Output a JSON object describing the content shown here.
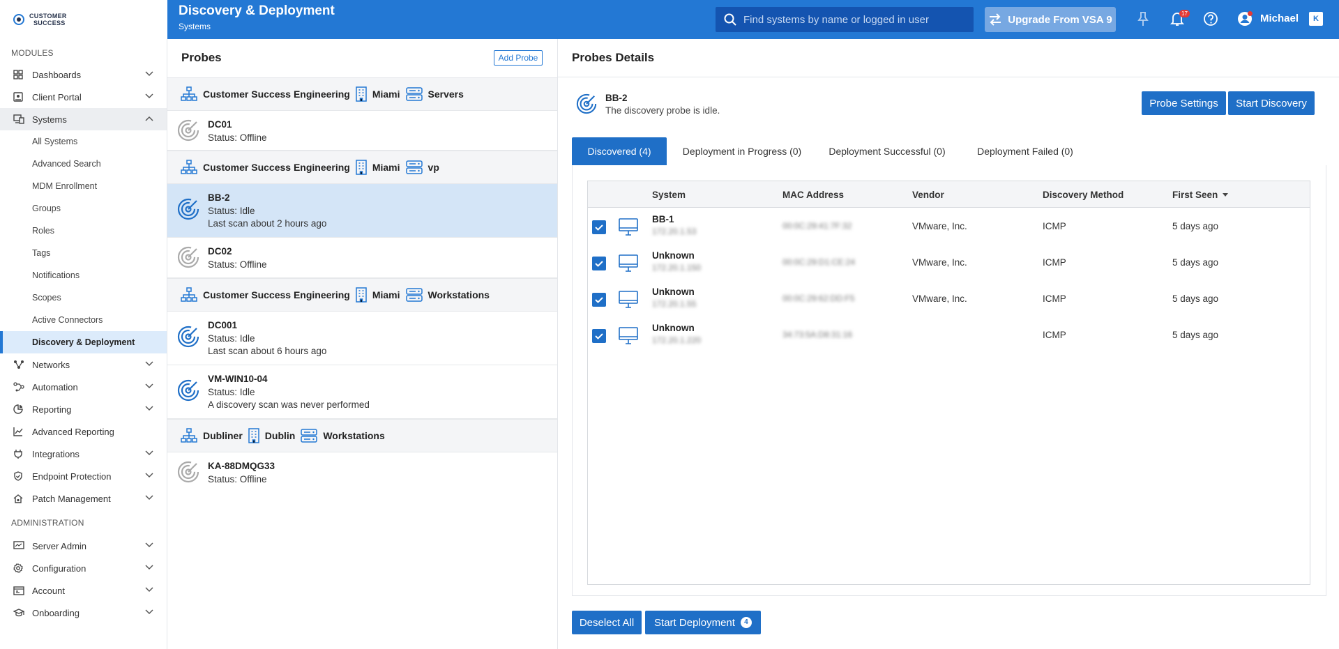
{
  "brand": {
    "logo_line1": "CUSTOMER",
    "logo_line2": "SUCCESS"
  },
  "header": {
    "title": "Discovery & Deployment",
    "subtitle": "Systems",
    "search_placeholder": "Find systems by name or logged in user",
    "upgrade_label": "Upgrade From VSA 9",
    "notification_count": "17",
    "user_name": "Michael",
    "app_badge": "K"
  },
  "sidebar": {
    "modules_label": "MODULES",
    "admin_label": "ADMINISTRATION",
    "items": [
      {
        "label": "Dashboards",
        "icon": "grid-icon"
      },
      {
        "label": "Client Portal",
        "icon": "portal-icon"
      },
      {
        "label": "Systems",
        "icon": "systems-icon"
      },
      {
        "label": "Networks",
        "icon": "network-icon"
      },
      {
        "label": "Automation",
        "icon": "automation-icon"
      },
      {
        "label": "Reporting",
        "icon": "reporting-icon"
      },
      {
        "label": "Advanced Reporting",
        "icon": "chart-line-icon"
      },
      {
        "label": "Integrations",
        "icon": "plug-icon"
      },
      {
        "label": "Endpoint Protection",
        "icon": "shield-icon"
      },
      {
        "label": "Patch Management",
        "icon": "home-gear-icon"
      }
    ],
    "systems_sub": [
      "All Systems",
      "Advanced Search",
      "MDM Enrollment",
      "Groups",
      "Roles",
      "Tags",
      "Notifications",
      "Scopes",
      "Active Connectors",
      "Discovery & Deployment"
    ],
    "admin_items": [
      {
        "label": "Server Admin",
        "icon": "server-admin-icon"
      },
      {
        "label": "Configuration",
        "icon": "gear-icon"
      },
      {
        "label": "Account",
        "icon": "account-icon"
      },
      {
        "label": "Onboarding",
        "icon": "graduation-cap-icon"
      }
    ]
  },
  "probes": {
    "title": "Probes",
    "add_label": "Add Probe",
    "groups": [
      {
        "org": "Customer Success Engineering",
        "site": "Miami",
        "group": "Servers"
      },
      {
        "org": "Customer Success Engineering",
        "site": "Miami",
        "group": "vp"
      },
      {
        "org": "Customer Success Engineering",
        "site": "Miami",
        "group": "Workstations"
      },
      {
        "org": "Dubliner",
        "site": "Dublin",
        "group": "Workstations"
      }
    ],
    "items": [
      {
        "name": "DC01",
        "status": "Status: Offline",
        "scan": ""
      },
      {
        "name": "BB-2",
        "status": "Status: Idle",
        "scan": "Last scan about 2 hours ago"
      },
      {
        "name": "DC02",
        "status": "Status: Offline",
        "scan": ""
      },
      {
        "name": "DC001",
        "status": "Status: Idle",
        "scan": "Last scan about 6 hours ago"
      },
      {
        "name": "VM-WIN10-04",
        "status": "Status: Idle",
        "scan": "A discovery scan was never performed"
      },
      {
        "name": "KA-88DMQG33",
        "status": "Status: Offline",
        "scan": ""
      }
    ]
  },
  "details": {
    "title": "Probes Details",
    "probe_name": "BB-2",
    "probe_status": "The discovery probe is idle.",
    "settings_label": "Probe Settings",
    "discovery_label": "Start Discovery",
    "tabs": [
      "Discovered (4)",
      "Deployment in Progress (0)",
      "Deployment Successful (0)",
      "Deployment Failed (0)"
    ],
    "columns": [
      "System",
      "MAC Address",
      "Vendor",
      "Discovery Method",
      "First Seen"
    ],
    "rows": [
      {
        "system": "BB-1",
        "ip": "172.20.1.53",
        "mac": "00:0C:29:41:7F:32",
        "vendor": "VMware, Inc.",
        "method": "ICMP",
        "seen": "5 days ago"
      },
      {
        "system": "Unknown",
        "ip": "172.20.1.150",
        "mac": "00:0C:29:D1:CE:24",
        "vendor": "VMware, Inc.",
        "method": "ICMP",
        "seen": "5 days ago"
      },
      {
        "system": "Unknown",
        "ip": "172.20.1.55",
        "mac": "00:0C:29:62:DD:F5",
        "vendor": "VMware, Inc.",
        "method": "ICMP",
        "seen": "5 days ago"
      },
      {
        "system": "Unknown",
        "ip": "172.20.1.220",
        "mac": "34:73:5A:D8:31:16",
        "vendor": "",
        "method": "ICMP",
        "seen": "5 days ago"
      }
    ],
    "deselect_label": "Deselect All",
    "deploy_label": "Start Deployment",
    "deploy_count": "4"
  }
}
